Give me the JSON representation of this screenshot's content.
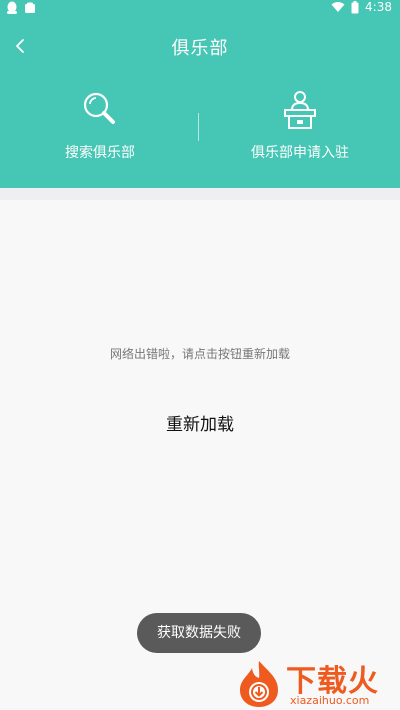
{
  "colors": {
    "accent": "#46c6b4",
    "toast_bg": "#5a5a5a",
    "watermark": "#ef5a1f"
  },
  "status_bar": {
    "time": "4:38",
    "icons_left": [
      "notification-penguin-icon",
      "notification-app-icon"
    ],
    "icons_right": [
      "wifi-icon",
      "battery-icon"
    ]
  },
  "header": {
    "back_icon": "chevron-left-icon",
    "title": "俱乐部"
  },
  "actions": {
    "search": {
      "icon": "magnifier-icon",
      "label": "搜索俱乐部"
    },
    "apply": {
      "icon": "podium-icon",
      "label": "俱乐部申请入驻"
    }
  },
  "error": {
    "message": "网络出错啦，请点击按钮重新加载",
    "reload_label": "重新加载"
  },
  "toast": {
    "message": "获取数据失败"
  },
  "watermark": {
    "brand": "下载火",
    "url": "xiazaihuo.com"
  }
}
